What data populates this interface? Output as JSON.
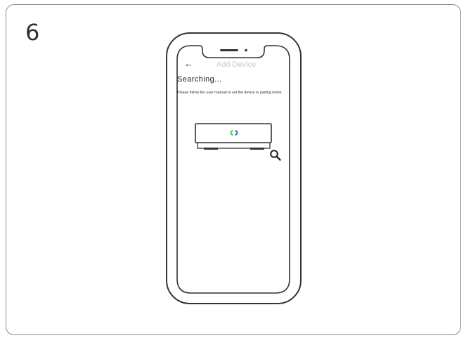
{
  "step": {
    "number": "6"
  },
  "screen": {
    "back_icon": "arrow-left-icon",
    "title": "Add Device",
    "status": "Searching...",
    "instruction": "Please follow the user manual to set the device in pairing mode.",
    "device_icon": "hub-device-icon",
    "search_icon": "magnifier-icon"
  },
  "colors": {
    "outline": "#333333",
    "card_border": "#8a8a8a",
    "title_muted": "#c9c9c9",
    "indicator_green": "#2fbf3a",
    "indicator_blue": "#1e5bd6"
  }
}
